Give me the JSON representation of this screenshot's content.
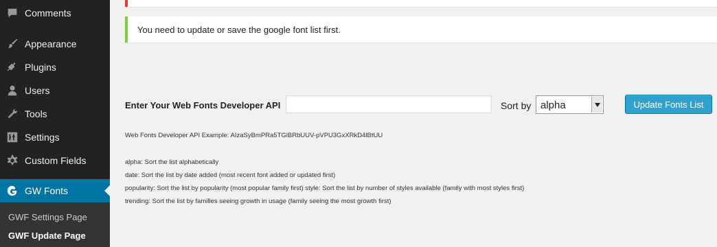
{
  "sidebar": {
    "items": [
      {
        "label": "Comments",
        "icon": "comment-icon"
      },
      {
        "label": "Appearance",
        "icon": "paintbrush-icon"
      },
      {
        "label": "Plugins",
        "icon": "plug-icon"
      },
      {
        "label": "Users",
        "icon": "user-icon"
      },
      {
        "label": "Tools",
        "icon": "wrench-icon"
      },
      {
        "label": "Settings",
        "icon": "settings-sliders-icon"
      },
      {
        "label": "Custom Fields",
        "icon": "gear-icon"
      },
      {
        "label": "GW Fonts",
        "icon": "google-g-icon"
      }
    ],
    "submenu": [
      {
        "label": "GWF Settings Page"
      },
      {
        "label": "GWF Update Page"
      }
    ],
    "active_color": "#0074a2"
  },
  "notice": {
    "message": "You need to update or save the google font list first."
  },
  "form": {
    "api_label": "Enter Your Web Fonts Developer API",
    "api_value": "",
    "sort_label": "Sort by",
    "sort_value": "alpha",
    "button_label": "Update Fonts List"
  },
  "help": {
    "example": "Web Fonts Developer API Example: AIzaSyBmPRa5TGlBRbUUV-pVPU3GxXRkD4lBtUU",
    "alpha": "alpha: Sort the list alphabetically",
    "date": "date: Sort the list by date added (most recent font added or updated first)",
    "popularity": "popularity: Sort the list by popularity (most popular family first) style: Sort the list by number of styles available (family with most styles first)",
    "trending": "trending: Sort the list by families seeing growth in usage (family seeing the most growth first)"
  }
}
